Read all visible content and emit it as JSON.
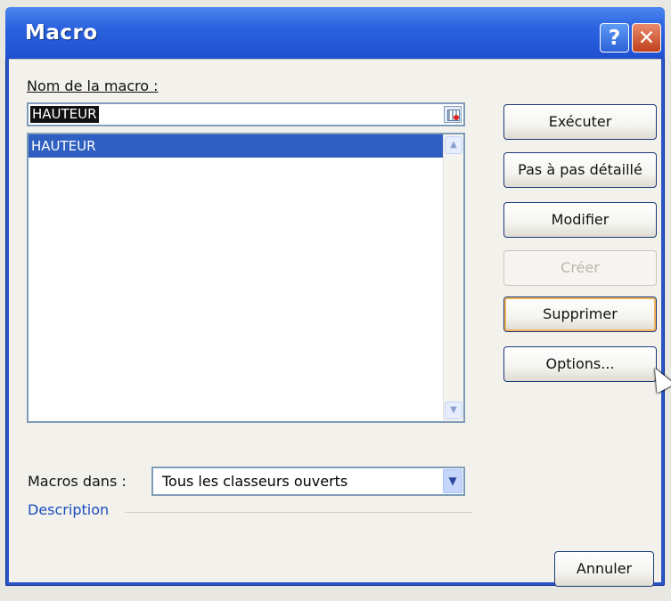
{
  "window": {
    "title": "Macro",
    "help_label": "?",
    "close_label": "✕"
  },
  "name_label": "Nom de la macro :",
  "name_value": "HAUTEUR",
  "macros": [
    "HAUTEUR"
  ],
  "buttons": {
    "execute": "Exécuter",
    "step": "Pas à pas détaillé",
    "edit": "Modifier",
    "create": "Créer",
    "delete": "Supprimer",
    "options": "Options...",
    "cancel": "Annuler"
  },
  "macros_in_label": "Macros dans :",
  "macros_in_value": "Tous les classeurs ouverts",
  "description_label": "Description",
  "icons": {
    "refedit": "refedit-icon",
    "scroll_up": "scroll-up-icon",
    "scroll_down": "scroll-down-icon",
    "dropdown": "chevron-down-icon",
    "cursor": "mouse-pointer-icon"
  },
  "colors": {
    "titlebar": "#2b63df",
    "selection": "#2f5fc0",
    "link": "#1b4dbd"
  }
}
